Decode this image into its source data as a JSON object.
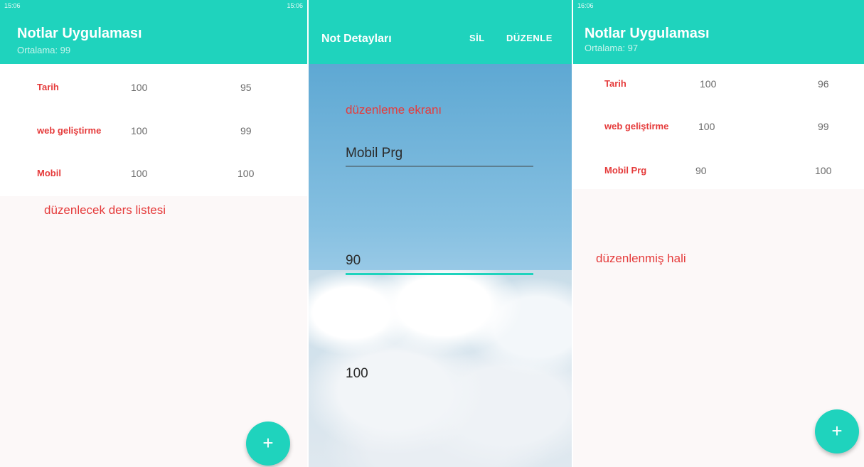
{
  "left": {
    "status_time": "15:06",
    "status_right": "15:06",
    "title": "Notlar Uygulaması",
    "subtitle": "Ortalama: 99",
    "rows": [
      {
        "name": "Tarih",
        "v1": "100",
        "v2": "95"
      },
      {
        "name": "web geliştirme",
        "v1": "100",
        "v2": "99"
      },
      {
        "name": "Mobil",
        "v1": "100",
        "v2": "100"
      }
    ],
    "annotation": "düzenlecek ders listesi",
    "fab_label": "+"
  },
  "middle": {
    "title": "Not Detayları",
    "action_delete": "SİL",
    "action_edit": "DÜZENLE",
    "annotation": "düzenleme ekranı",
    "field_name": "Mobil Prg",
    "field_grade1": "90",
    "field_grade2": "100"
  },
  "right": {
    "status_time": "16:06",
    "title": "Notlar Uygulaması",
    "subtitle": "Ortalama: 97",
    "rows": [
      {
        "name": "Tarih",
        "v1": "100",
        "v2": "96"
      },
      {
        "name": "web geliştirme",
        "v1": "100",
        "v2": "99"
      },
      {
        "name": "Mobil Prg",
        "v1": "90",
        "v2": "100"
      }
    ],
    "annotation": "düzenlenmiş hali",
    "fab_label": "+"
  },
  "colors": {
    "accent": "#1fd3bd",
    "note_red": "#e53b3b"
  }
}
